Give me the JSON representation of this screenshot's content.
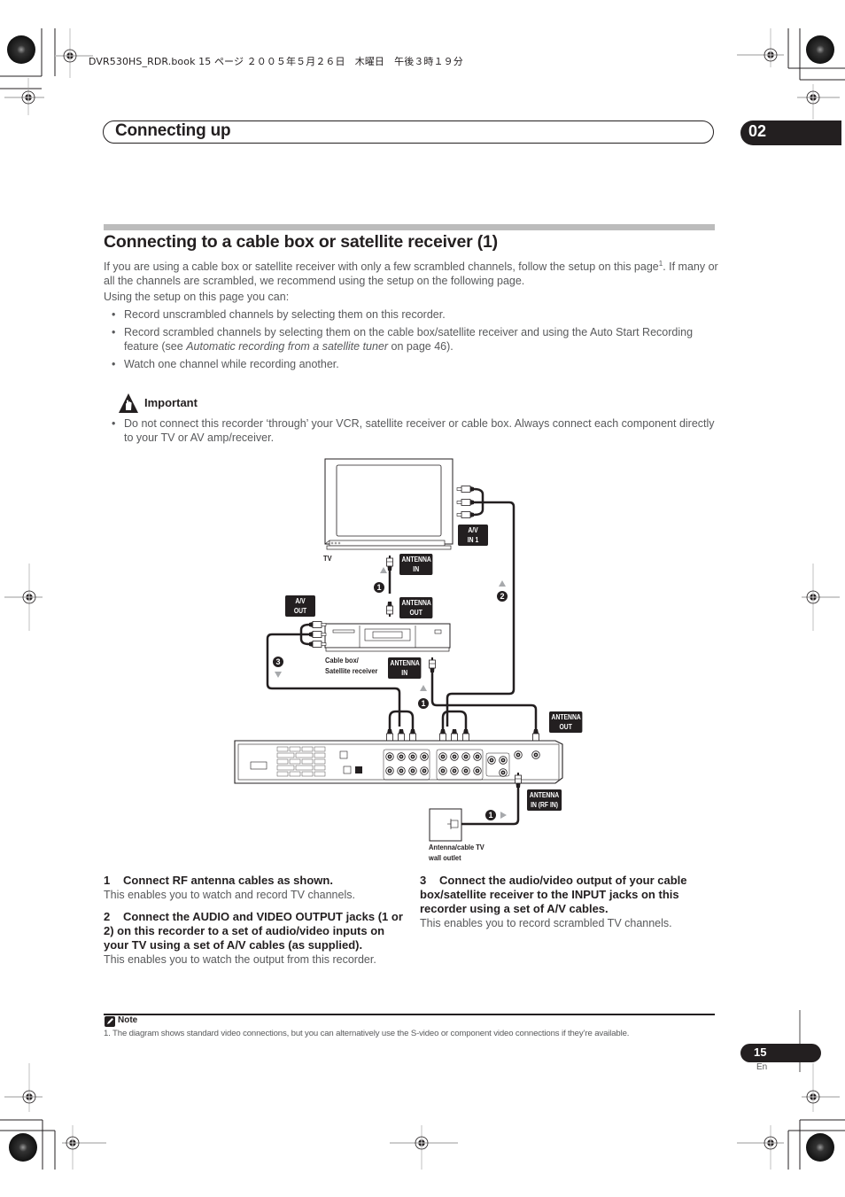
{
  "print_header": "DVR530HS_RDR.book  15 ページ  ２００５年５月２６日　木曜日　午後３時１９分",
  "header": {
    "section_title": "Connecting up",
    "chapter_number": "02"
  },
  "section": {
    "title": "Connecting to a cable box or satellite receiver (1)",
    "intro_text": "If you are using a cable box or satellite receiver with only a few scrambled channels, follow the setup on this page",
    "intro_footnote_ref": "1",
    "intro_text_cont": ". If many or all the channels are scrambled, we recommend using the setup on the following page.",
    "lead_in": "Using the setup on this page you can:",
    "bullets": [
      {
        "text": "Record unscrambled channels by selecting them on this recorder."
      },
      {
        "text_before": "Record scrambled channels by selecting them on the cable box/satellite receiver and using the Auto Start Recording feature (see ",
        "italic": "Automatic recording from a satellite tuner",
        "text_after": " on page 46)."
      },
      {
        "text": "Watch one channel while recording another."
      }
    ]
  },
  "important": {
    "label": "Important",
    "icon": "warning-hand-icon",
    "bullets": [
      "Do not connect this recorder ‘through’ your VCR, satellite receiver or cable box. Always connect each component directly to your TV or AV amp/receiver."
    ]
  },
  "diagram": {
    "labels": {
      "tv": "TV",
      "av_in1": [
        "A/V",
        "IN 1"
      ],
      "tv_antenna_in": [
        "ANTENNA",
        "IN"
      ],
      "cable_antenna_out": [
        "ANTENNA",
        "OUT"
      ],
      "av_out": [
        "A/V",
        "OUT"
      ],
      "cable_box": [
        "Cable box/",
        "Satellite receiver"
      ],
      "cable_antenna_in": [
        "ANTENNA",
        "IN"
      ],
      "recorder_antenna_out": [
        "ANTENNA",
        "OUT"
      ],
      "recorder_antenna_in": [
        "ANTENNA",
        "IN (RF IN)"
      ],
      "wall_outlet": [
        "Antenna/cable TV",
        "wall outlet"
      ]
    },
    "step_markers": [
      "1",
      "2",
      "3"
    ]
  },
  "steps": [
    {
      "number": "1",
      "heading": "Connect RF antenna cables as shown.",
      "body": "This enables you to watch and record TV channels."
    },
    {
      "number": "2",
      "heading": "Connect the AUDIO and VIDEO OUTPUT jacks (1 or 2) on this recorder to a set of audio/video inputs on your TV using a set of A/V cables (as supplied).",
      "body": "This enables you to watch the output from this recorder."
    },
    {
      "number": "3",
      "heading": "Connect the audio/video output of your cable box/satellite receiver to the INPUT  jacks on this recorder using a set of A/V cables.",
      "body": "This enables you to record scrambled TV channels."
    }
  ],
  "note": {
    "label": "Note",
    "text": "1. The diagram shows standard video connections, but you can alternatively use the S-video or component video connections if they’re available."
  },
  "footer": {
    "page_number": "15",
    "language": "En"
  },
  "colors": {
    "ink": "#231f20",
    "body_grey": "#58595b",
    "rule_grey": "#bcbcbc"
  }
}
